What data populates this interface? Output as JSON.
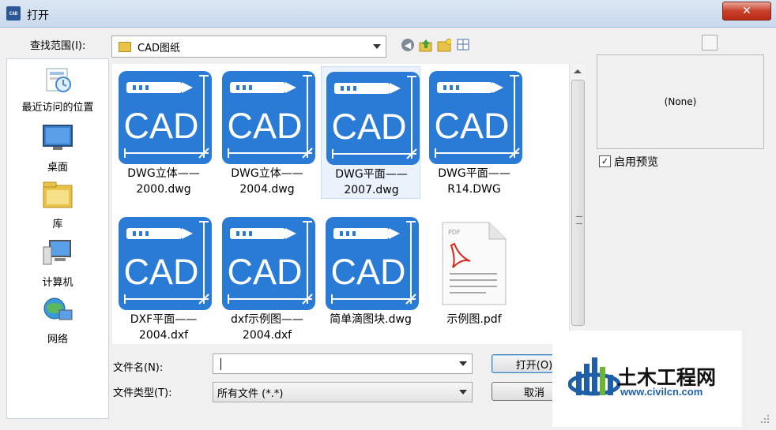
{
  "window": {
    "title": "打开",
    "app_icon_text": "CAD",
    "close_label": "✕"
  },
  "toolbar": {
    "look_in_label": "查找范围(I):",
    "look_in_value": "CAD图纸"
  },
  "places": [
    {
      "label": "最近访问的位置",
      "icon": "recent-places-icon"
    },
    {
      "label": "桌面",
      "icon": "desktop-icon"
    },
    {
      "label": "库",
      "icon": "libraries-icon"
    },
    {
      "label": "计算机",
      "icon": "computer-icon"
    },
    {
      "label": "网络",
      "icon": "network-icon"
    }
  ],
  "cad_icon_text": "CAD",
  "files": [
    {
      "line1": "DWG立体——",
      "line2": "2000.dwg",
      "type": "cad"
    },
    {
      "line1": "DWG立体——",
      "line2": "2004.dwg",
      "type": "cad"
    },
    {
      "line1": "DWG平面——",
      "line2": "2007.dwg",
      "type": "cad",
      "selected": true
    },
    {
      "line1": "DWG平面——",
      "line2": "R14.DWG",
      "type": "cad"
    },
    {
      "line1": "DXF平面——",
      "line2": "2004.dxf",
      "type": "cad"
    },
    {
      "line1": "dxf示例图——",
      "line2": "2004.dxf",
      "type": "cad"
    },
    {
      "line1": "简单滴图块.dwg",
      "line2": "",
      "type": "cad"
    },
    {
      "line1": "示例图.pdf",
      "line2": "",
      "type": "pdf"
    }
  ],
  "pdf_badge": "PDF",
  "bottom": {
    "filename_label": "文件名(N):",
    "filename_value": "",
    "filetype_label": "文件类型(T):",
    "filetype_value": "所有文件 (*.*)",
    "open_label": "打开(O)",
    "cancel_label": "取消"
  },
  "preview": {
    "text": "(None)",
    "enable_label": "启用预览",
    "enabled": true
  },
  "watermark": {
    "title": "土木工程网",
    "url": "www.civilcn.com"
  },
  "colors": {
    "cad_blue": "#2a7bd5",
    "selection": "#eaf3fc",
    "watermark_blue": "#1f5fa8"
  }
}
